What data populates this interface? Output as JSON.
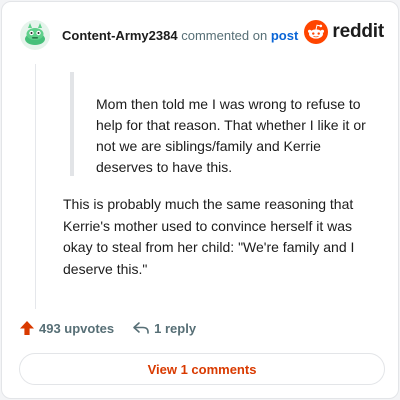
{
  "header": {
    "username": "Content-Army2384",
    "action_text": "commented on",
    "post_link": "post",
    "brand": "reddit"
  },
  "comment": {
    "quote": "Mom then told me I was wrong to refuse to help for that reason. That whether I like it or not we are siblings/family and Kerrie deserves to have this.",
    "body": "This is probably much the same reasoning that Kerrie's mother used to convince herself it was okay to steal from her child: \"We're family and I deserve this.\""
  },
  "actions": {
    "upvotes": "493 upvotes",
    "reply": "1 reply"
  },
  "footer": {
    "view_comments": "View 1 comments"
  },
  "colors": {
    "brand": "#ff4500",
    "upvote": "#d93a00",
    "link": "#0a65d6"
  },
  "icons": [
    "avatar-snoo-icon",
    "reddit-logo-icon",
    "upvote-arrow-icon",
    "reply-arrow-icon"
  ]
}
